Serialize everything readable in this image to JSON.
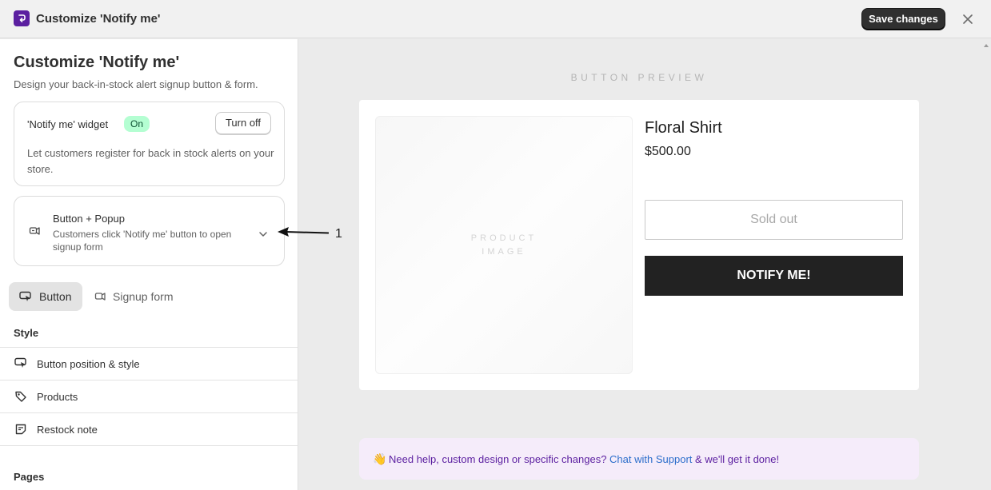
{
  "titlebar": {
    "title": "Customize 'Notify me'",
    "save_label": "Save changes"
  },
  "sidebar": {
    "title": "Customize 'Notify me'",
    "subtitle": "Design your back-in-stock alert signup button & form.",
    "widget": {
      "label": "'Notify me' widget",
      "status": "On",
      "turn_off_label": "Turn off",
      "description": "Let customers register for back in stock alerts on your store."
    },
    "mode": {
      "title": "Button + Popup",
      "description": "Customers click 'Notify me' button to open signup form"
    },
    "tabs": [
      {
        "label": "Button",
        "active": true
      },
      {
        "label": "Signup form",
        "active": false
      }
    ],
    "style_heading": "Style",
    "style_items": [
      {
        "label": "Button position & style",
        "icon": "cursor-box-icon"
      },
      {
        "label": "Products",
        "icon": "tag-icon"
      },
      {
        "label": "Restock note",
        "icon": "note-icon"
      }
    ],
    "pages_heading": "Pages"
  },
  "annotation": {
    "label": "1"
  },
  "preview": {
    "label": "BUTTON PREVIEW",
    "image_placeholder_line1": "PRODUCT",
    "image_placeholder_line2": "IMAGE",
    "product_name": "Floral Shirt",
    "price": "$500.00",
    "sold_out_label": "Sold out",
    "notify_label": "NOTIFY ME!"
  },
  "help": {
    "emoji": "👋",
    "text_before": "Need help, custom design or specific changes? ",
    "link": "Chat with Support",
    "text_after": " & we'll get it done!"
  },
  "colors": {
    "brand": "#5b1fa0",
    "primary_button": "#303030",
    "badge_on_bg": "#b4fed2",
    "notify_button": "#222222",
    "help_bg": "#f5ecfa",
    "link": "#2c6ecb"
  }
}
